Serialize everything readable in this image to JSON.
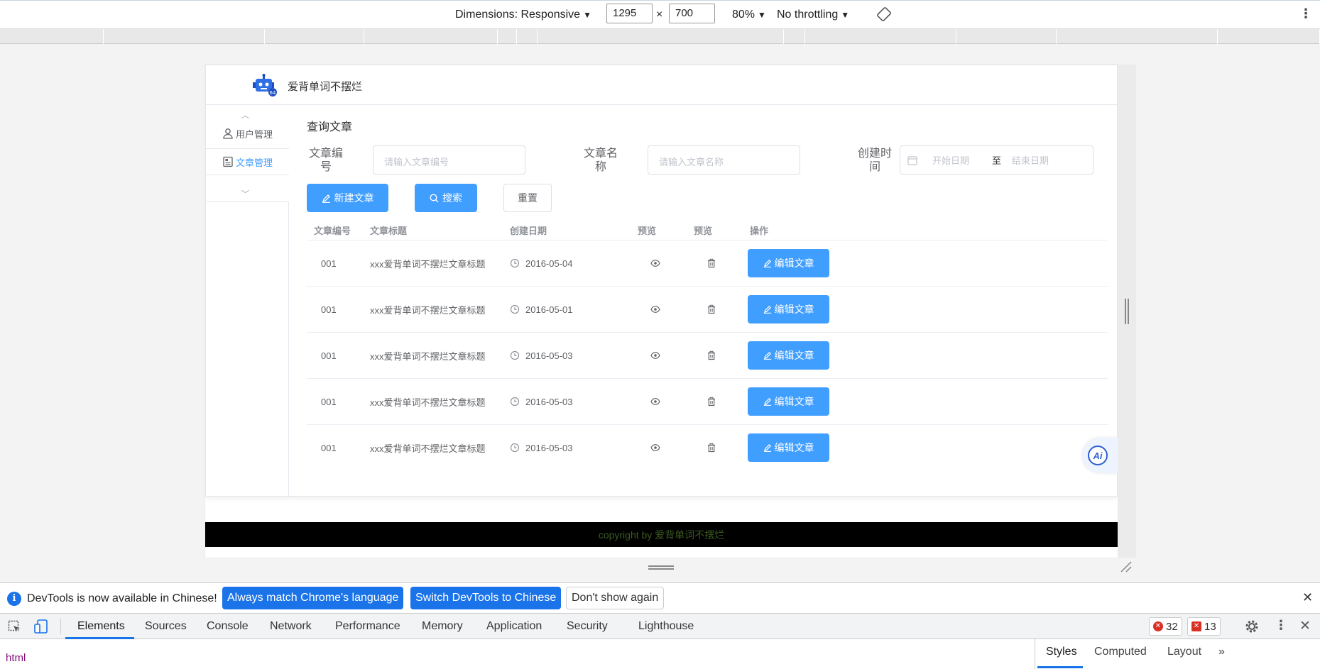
{
  "device_toolbar": {
    "dimensions_label": "Dimensions: Responsive",
    "width": "1295",
    "height": "700",
    "times": "×",
    "zoom": "80%",
    "throttling": "No throttling"
  },
  "app": {
    "brand": "爱背单词不摆烂",
    "sidebar": {
      "items": [
        {
          "label": "用户管理",
          "icon": "user-icon"
        },
        {
          "label": "文章管理",
          "icon": "document-icon"
        }
      ]
    },
    "page_title": "查询文章",
    "filters": {
      "article_no_label": "文章编号",
      "article_no_placeholder": "请输入文章编号",
      "article_name_label": "文章名称",
      "article_name_placeholder": "请输入文章名称",
      "created_label": "创建时间",
      "start_placeholder": "开始日期",
      "range_sep": "至",
      "end_placeholder": "结束日期"
    },
    "buttons": {
      "new": "新建文章",
      "search": "搜索",
      "reset": "重置"
    },
    "table": {
      "columns": [
        "文章编号",
        "文章标题",
        "创建日期",
        "预览",
        "预览",
        "操作"
      ],
      "rows": [
        {
          "no": "001",
          "title": "xxx爱背单词不摆烂文章标题",
          "date": "2016-05-04",
          "action": "编辑文章"
        },
        {
          "no": "001",
          "title": "xxx爱背单词不摆烂文章标题",
          "date": "2016-05-01",
          "action": "编辑文章"
        },
        {
          "no": "001",
          "title": "xxx爱背单词不摆烂文章标题",
          "date": "2016-05-03",
          "action": "编辑文章"
        },
        {
          "no": "001",
          "title": "xxx爱背单词不摆烂文章标题",
          "date": "2016-05-03",
          "action": "编辑文章"
        },
        {
          "no": "001",
          "title": "xxx爱背单词不摆烂文章标题",
          "date": "2016-05-03",
          "action": "编辑文章"
        }
      ]
    },
    "ai_badge": "Ai",
    "footer": "copyright by 爱背单词不摆烂"
  },
  "infobar": {
    "message": "DevTools is now available in Chinese!",
    "btn_match": "Always match Chrome's language",
    "btn_switch": "Switch DevTools to Chinese",
    "btn_dismiss": "Don't show again"
  },
  "devtools": {
    "tabs": [
      "Elements",
      "Sources",
      "Console",
      "Network",
      "Performance",
      "Memory",
      "Application",
      "Security",
      "Lighthouse"
    ],
    "errors": "32",
    "issues": "13",
    "breadcrumb": "html",
    "side_tabs": [
      "Styles",
      "Computed",
      "Layout"
    ]
  },
  "colors": {
    "primary": "#409eff",
    "devtools_blue": "#1a73e8",
    "footer_bg": "#000000",
    "error_red": "#d93025"
  }
}
